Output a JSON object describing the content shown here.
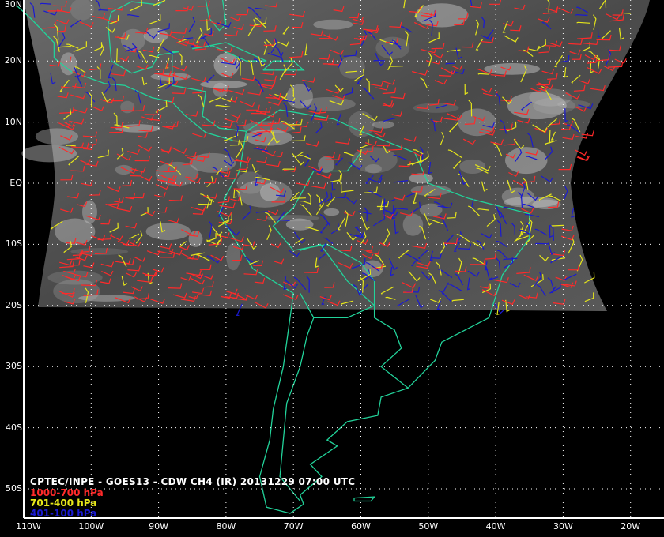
{
  "title": "CPTEC/INPE - GOES13 - CDW CH4 (IR) 20131229 07:00 UTC",
  "legend": [
    {
      "label": "1000-700 hPa",
      "color": "#ff2a2a"
    },
    {
      "label": "701-400 hPa",
      "color": "#e6e61a"
    },
    {
      "label": "401-100 hPa",
      "color": "#1a1ad2"
    }
  ],
  "lat_labels": [
    "30N",
    "20N",
    "10N",
    "EQ",
    "10S",
    "20S",
    "30S",
    "40S",
    "50S"
  ],
  "lon_labels": [
    "110W",
    "100W",
    "90W",
    "80W",
    "70W",
    "60W",
    "50W",
    "40W",
    "30W",
    "20W"
  ],
  "colors": {
    "coast": "#22d39a",
    "grid": "#ffffff",
    "background": "#000000"
  }
}
